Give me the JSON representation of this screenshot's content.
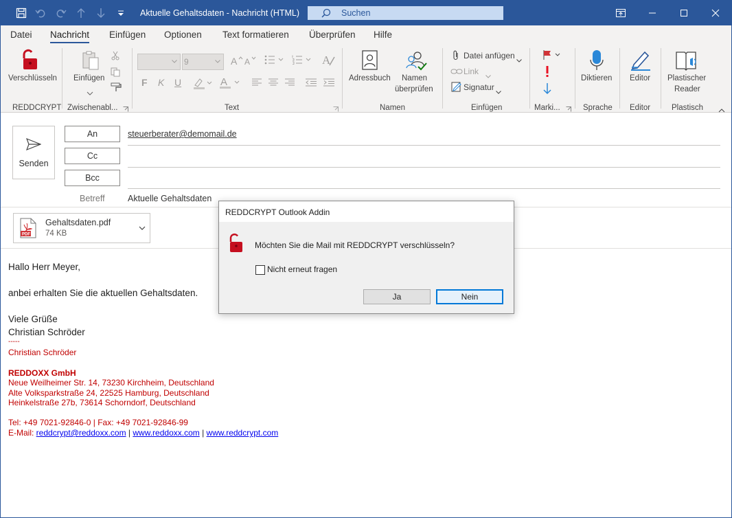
{
  "titlebar": {
    "title": "Aktuelle Gehaltsdaten  -  Nachricht (HTML)",
    "search_label": "Suchen"
  },
  "menu": {
    "tabs": [
      {
        "label": "Datei"
      },
      {
        "label": "Nachricht",
        "active": true
      },
      {
        "label": "Einfügen"
      },
      {
        "label": "Optionen"
      },
      {
        "label": "Text formatieren"
      },
      {
        "label": "Überprüfen"
      },
      {
        "label": "Hilfe"
      }
    ]
  },
  "ribbon": {
    "reddcrypt": {
      "button": "Verschlüsseln",
      "group": "REDDCRYPT"
    },
    "clipboard": {
      "button": "Einfügen",
      "group": "Zwischenabl..."
    },
    "text": {
      "font_size": "9",
      "bold": "F",
      "italic": "K",
      "underline": "U",
      "group": "Text"
    },
    "names": {
      "addressbook": "Adressbuch",
      "check_line1": "Namen",
      "check_line2": "überprüfen",
      "group": "Namen"
    },
    "insert": {
      "attach": "Datei anfügen",
      "link": "Link",
      "signature": "Signatur",
      "group": "Einfügen"
    },
    "tags": {
      "group": "Marki..."
    },
    "voice": {
      "button": "Diktieren",
      "group": "Sprache"
    },
    "editor": {
      "button": "Editor",
      "group": "Editor"
    },
    "reader": {
      "line1": "Plastischer",
      "line2": "Reader",
      "group": "Plastisch"
    }
  },
  "compose": {
    "send_label": "Senden",
    "to_label": "An",
    "cc_label": "Cc",
    "bcc_label": "Bcc",
    "to_value": "steuerberater@demomail.de",
    "subject_label": "Betreff",
    "subject_value": "Aktuelle Gehaltsdaten"
  },
  "attachment": {
    "name": "Gehaltsdaten.pdf",
    "size": "74 KB",
    "icon_text": "PDF"
  },
  "body": {
    "greeting": "Hallo Herr Meyer,",
    "line1": "anbei erhalten Sie die aktuellen Gehaltsdaten.",
    "closing": "Viele Grüße",
    "name": "Christian Schröder"
  },
  "signature": {
    "dashes": "-----",
    "name": "Christian Schröder",
    "company": "REDDOXX GmbH",
    "address1": "Neue Weilheimer Str. 14, 73230 Kirchheim, Deutschland",
    "address2": "Alte Volksparkstraße 24, 22525 Hamburg, Deutschland",
    "address3": "Heinkelstraße 27b, 73614 Schorndorf, Deutschland",
    "tel": "Tel: +49 7021-92846-0 | Fax: +49 7021-92846-99",
    "email_prefix": "E-Mail: ",
    "email": "reddcrypt@reddoxx.com",
    "link1": "www.reddoxx.com",
    "link2": "www.reddcrypt.com",
    "sep": " | "
  },
  "dialog": {
    "title": "REDDCRYPT Outlook Addin",
    "message": "Möchten Sie die Mail mit REDDCRYPT verschlüsseln?",
    "checkbox_label": "Nicht erneut fragen",
    "yes": "Ja",
    "no": "Nein"
  },
  "colors": {
    "titlebar": "#2b579a",
    "signature_red": "#c00000",
    "lock_red": "#c50f1f"
  }
}
